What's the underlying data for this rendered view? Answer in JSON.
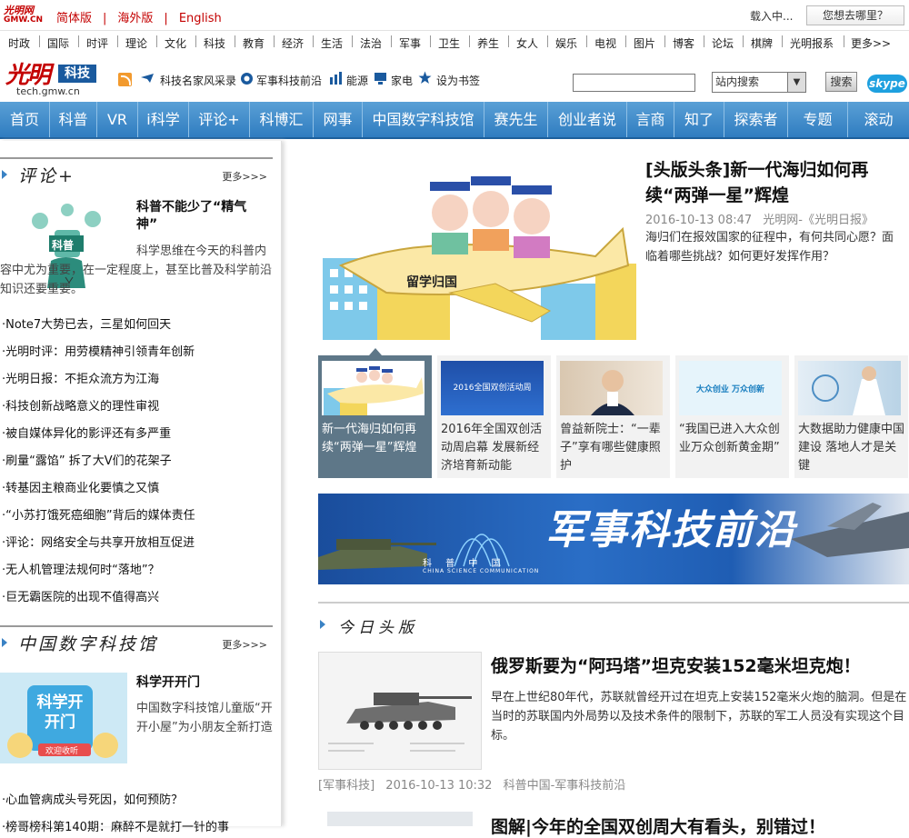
{
  "topbar": {
    "logo_text": "光明网",
    "logo_sub": "GMW.CN",
    "links": [
      "简体版",
      "海外版",
      "English"
    ],
    "separator": "|",
    "loading": "载入中...",
    "where_button": "您想去哪里？"
  },
  "channels": [
    "时政",
    "国际",
    "时评",
    "理论",
    "文化",
    "科技",
    "教育",
    "经济",
    "生活",
    "法治",
    "军事",
    "卫生",
    "养生",
    "女人",
    "娱乐",
    "电视",
    "图片",
    "博客",
    "论坛",
    "棋牌",
    "光明报系",
    "更多>>"
  ],
  "header": {
    "logo_main": "光明",
    "logo_tag": "科技",
    "logo_url": "tech.gmw.cn",
    "links": [
      "科技名家风采录",
      "军事科技前沿",
      "能源",
      "家电",
      "设为书签"
    ],
    "search_select": "站内搜索",
    "search_button": "搜索",
    "skype": "skype"
  },
  "mainnav": [
    "首页",
    "科普",
    "VR",
    "i科学",
    "评论+",
    "科博汇",
    "网事",
    "中国数字科技馆",
    "赛先生",
    "创业者说",
    "言商",
    "知了",
    "探索者",
    "专题",
    "滚动"
  ],
  "left": {
    "sec1": {
      "title": "评论+",
      "more": "更多>>>",
      "feature_title": "科普不能少了“精气神”",
      "feature_summary": "科学思维在今天的科普内容中尤为重要，在一定程度上，甚至比普及科学前沿知识还要重要。",
      "image_label": "科普",
      "items": [
        "·Note7大势已去，三星如何回天",
        "·光明时评：用劳模精神引领青年创新",
        "·光明日报：不拒众流方为江海",
        "·科技创新战略意义的理性审视",
        "·被自媒体异化的影评还有多严重",
        "·刷量“露馅” 拆了大V们的花架子",
        "·转基因主粮商业化要慎之又慎",
        "·“小苏打饿死癌细胞”背后的媒体责任",
        "·评论：网络安全与共享开放相互促进",
        "·无人机管理法规何时“落地”？",
        "·巨无霸医院的出现不值得高兴"
      ]
    },
    "sec2": {
      "title": "中国数字科技馆",
      "more": "更多>>>",
      "feature_title": "科学开开门",
      "feature_summary": "中国数字科技馆儿童版“开开小屋”为小朋友全新打造",
      "image_text": "科学开开门",
      "image_badge": "欢迎收听",
      "items": [
        "·心血管病成头号死因，如何预防？",
        "·榜哥榜科第140期：麻醉不是就打一针的事"
      ]
    }
  },
  "hero": {
    "title": "[头版头条]新一代海归如何再续“两弹一星”辉煌",
    "date": "2016-10-13 08:47",
    "source": "光明网-《光明日报》",
    "summary": "海归们在报效国家的征程中，有何共同心愿？面临着哪些挑战？如何更好发挥作用？",
    "image_label": "留学归国"
  },
  "thumbs": [
    {
      "caption": "新一代海归如何再续“两弹一星”辉煌",
      "active": true
    },
    {
      "caption": "2016年全国双创活动周启幕 发展新经济培育新动能",
      "pic_text": "2016全国双创活动周"
    },
    {
      "caption": "曾益新院士：“一辈子”享有哪些健康照护"
    },
    {
      "caption": "“我国已进入大众创业万众创新黄金期”",
      "pic_text": "大众创业 万众创新"
    },
    {
      "caption": "大数据助力健康中国建设 落地人才是关键"
    }
  ],
  "banner": {
    "title": "军事科技前沿",
    "brand": "科 普 中 国",
    "brand_en": "CHINA SCIENCE COMMUNICATION"
  },
  "today": {
    "title": "今日头版",
    "article": {
      "title": "俄罗斯要为“阿玛塔”坦克安装152毫米坦克炮！",
      "summary": "早在上世纪80年代，苏联就曾经开过在坦克上安装152毫米火炮的脑洞。但是在当时的苏联国内外局势以及技术条件的限制下，苏联的军工人员没有实现这个目标。",
      "tag": "[军事科技]",
      "date": "2016-10-13 10:32",
      "source": "科普中国-军事科技前沿"
    },
    "article2_title": "图解|今年的全国双创周大有看头，别错过！"
  }
}
